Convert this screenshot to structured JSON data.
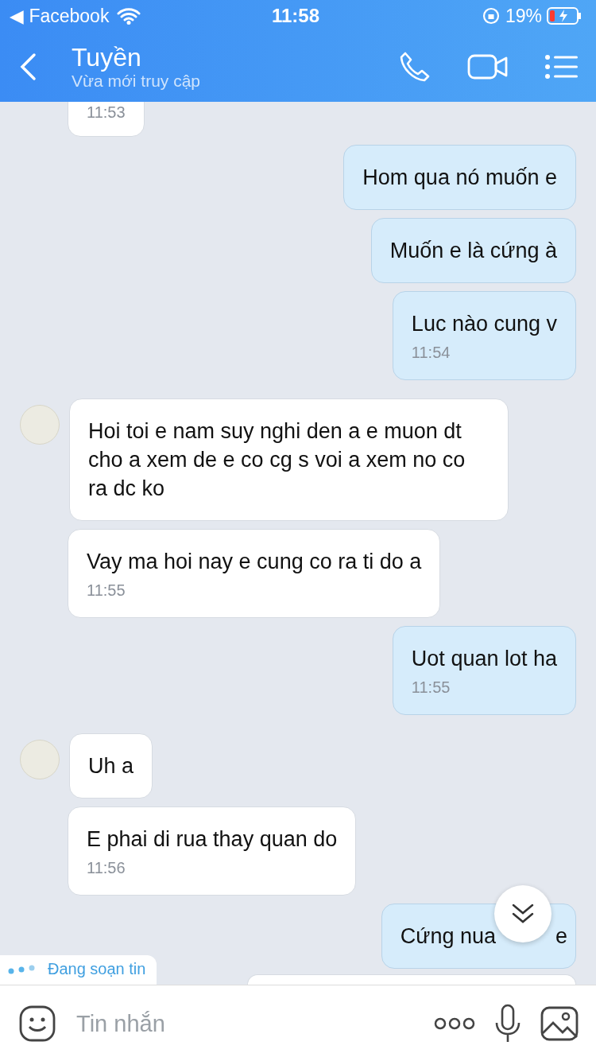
{
  "status_bar": {
    "back_app": "◀ Facebook",
    "time": "11:58",
    "battery": "19%"
  },
  "header": {
    "name": "Tuyền",
    "subtitle": "Vừa mới truy cập"
  },
  "messages": [
    {
      "kind": "incoming",
      "avatar": false,
      "time": "11:53"
    },
    {
      "kind": "outgoing",
      "avatar": false,
      "text": "Hom qua nó muốn e"
    },
    {
      "kind": "outgoing",
      "avatar": false,
      "text": "Muốn e là cứng à"
    },
    {
      "kind": "outgoing",
      "avatar": false,
      "text": "Luc nào cung v",
      "time": "11:54"
    },
    {
      "kind": "incoming",
      "avatar": true,
      "text": "Hoi toi e nam suy nghi den a e muon dt cho a xem de e co cg s voi a xem no co ra dc ko"
    },
    {
      "kind": "incoming",
      "avatar": false,
      "text": "Vay ma hoi nay e cung co ra ti do a",
      "time": "11:55"
    },
    {
      "kind": "outgoing",
      "avatar": false,
      "text": "Uot quan lot ha",
      "time": "11:55"
    },
    {
      "kind": "incoming",
      "avatar": true,
      "text": "Uh a"
    },
    {
      "kind": "incoming",
      "avatar": false,
      "text": "E phai di rua thay quan do",
      "time": "11:56"
    },
    {
      "kind": "outgoing",
      "avatar": false,
      "text": "Cứng nua",
      "tail": "e"
    }
  ],
  "clipped_bubble": true,
  "typing": {
    "label": "Đang soạn tin"
  },
  "composer": {
    "placeholder": "Tin nhắn"
  }
}
